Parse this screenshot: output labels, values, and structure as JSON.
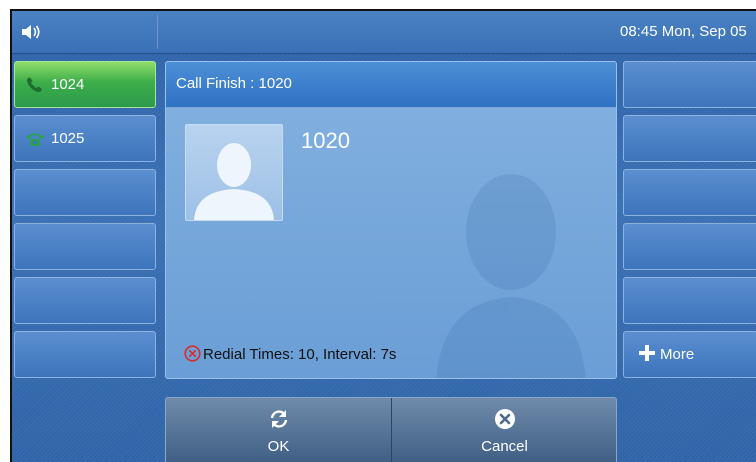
{
  "status_bar": {
    "volume_icon": "speaker-icon",
    "datetime": "08:45 Mon, Sep 05"
  },
  "line_keys": [
    {
      "label": "1024",
      "icon": "phone-handset-icon",
      "state": "active"
    },
    {
      "label": "1025",
      "icon": "phone-classic-icon",
      "state": "idle"
    }
  ],
  "dialog": {
    "title": "Call Finish : 1020",
    "caller_number": "1020",
    "avatar_icon": "contact-avatar-icon",
    "redial_status_icon": "red-cancel-circle-icon",
    "redial_text": "Redial Times: 10, Interval: 7s"
  },
  "side_keys": {
    "more_label": "More",
    "more_icon": "plus-icon"
  },
  "softkeys": {
    "ok_label": "OK",
    "ok_icon": "refresh-icon",
    "cancel_label": "Cancel",
    "cancel_icon": "close-circle-icon"
  },
  "colors": {
    "active_line": "#3cae4a",
    "accent_blue": "#2f71c2",
    "redial_icon": "#d62b2b"
  }
}
